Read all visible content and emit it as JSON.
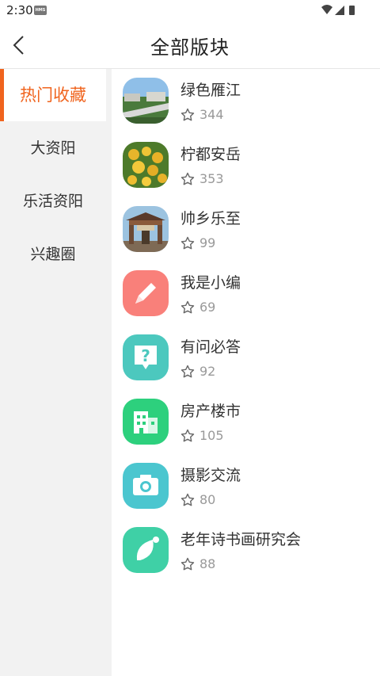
{
  "status": {
    "time": "2:30",
    "badge": "HMS"
  },
  "header": {
    "title": "全部版块"
  },
  "sidebar": {
    "items": [
      {
        "label": "热门收藏",
        "active": true
      },
      {
        "label": "大资阳",
        "active": false
      },
      {
        "label": "乐活资阳",
        "active": false
      },
      {
        "label": "兴趣圈",
        "active": false
      }
    ]
  },
  "boards": [
    {
      "name": "绿色雁江",
      "count": "344",
      "icon": "photo-city-icon"
    },
    {
      "name": "柠都安岳",
      "count": "353",
      "icon": "photo-lemon-icon"
    },
    {
      "name": "帅乡乐至",
      "count": "99",
      "icon": "photo-gate-icon"
    },
    {
      "name": "我是小编",
      "count": "69",
      "icon": "pencil-icon",
      "color": "#f9807a"
    },
    {
      "name": "有问必答",
      "count": "92",
      "icon": "question-icon",
      "color": "#4cc8be"
    },
    {
      "name": "房产楼市",
      "count": "105",
      "icon": "building-icon",
      "color": "#2dd07d"
    },
    {
      "name": "摄影交流",
      "count": "80",
      "icon": "camera-icon",
      "color": "#4bc6cf"
    },
    {
      "name": "老年诗书画研究会",
      "count": "88",
      "icon": "leaf-icon",
      "color": "#3fd0a6"
    }
  ],
  "colors": {
    "accent": "#f0641e"
  }
}
